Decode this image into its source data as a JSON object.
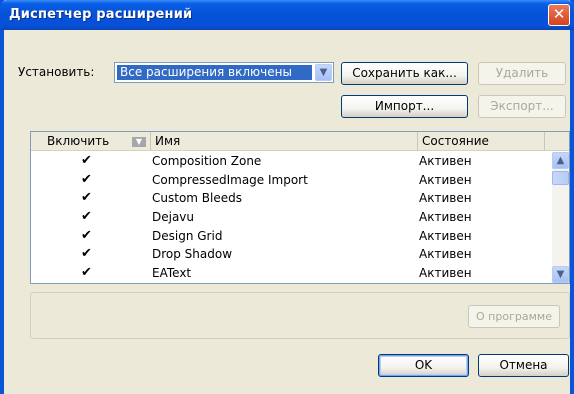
{
  "window": {
    "title": "Диспетчер расширений",
    "close_symbol": "✕"
  },
  "set": {
    "label": "Установить:",
    "selected": "Все расширения включены",
    "arrow": "▼"
  },
  "buttons": {
    "save_as": "Сохранить как...",
    "delete": "Удалить",
    "import": "Импорт...",
    "export": "Экспорт...",
    "about": "О программе",
    "ok": "OK",
    "cancel": "Отмена"
  },
  "table": {
    "headers": {
      "enable": "Включить",
      "name": "Имя",
      "status": "Состояние"
    },
    "rows": [
      {
        "check": "✔",
        "name": "Composition Zone",
        "status": "Активен"
      },
      {
        "check": "✔",
        "name": "CompressedImage Import",
        "status": "Активен"
      },
      {
        "check": "✔",
        "name": "Custom Bleeds",
        "status": "Активен"
      },
      {
        "check": "✔",
        "name": "Dejavu",
        "status": "Активен"
      },
      {
        "check": "✔",
        "name": "Design Grid",
        "status": "Активен"
      },
      {
        "check": "✔",
        "name": "Drop Shadow",
        "status": "Активен"
      },
      {
        "check": "✔",
        "name": "EAText",
        "status": "Активен"
      }
    ]
  },
  "icons": {
    "scroll_up": "▲",
    "scroll_down": "▼",
    "sort": "▼"
  }
}
